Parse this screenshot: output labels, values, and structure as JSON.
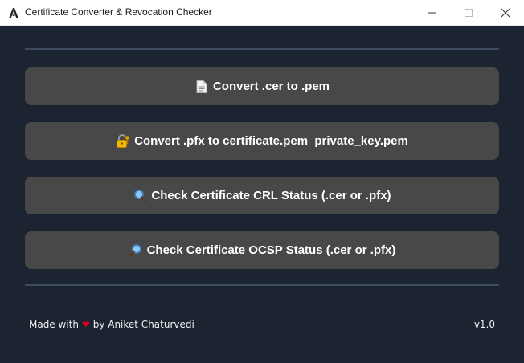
{
  "window": {
    "title": "Certificate Converter & Revocation Checker",
    "controls": {
      "minimize": "—",
      "maximize": "☐",
      "close": "✕"
    }
  },
  "buttons": [
    {
      "label": "Convert .cer to .pem",
      "icon": "document-icon"
    },
    {
      "label": "Convert .pfx to certificate.pem  private_key.pem",
      "icon": "lock-key-icon"
    },
    {
      "label": "Check Certificate CRL Status (.cer or .pfx)",
      "icon": "magnifier-icon"
    },
    {
      "label": "Check Certificate OCSP Status (.cer or .pfx)",
      "icon": "magnifier-icon"
    }
  ],
  "footer": {
    "made_with": "Made with",
    "heart": "❤",
    "by": "by Aniket Chaturvedi",
    "version": "v1.0"
  },
  "colors": {
    "background": "#1b2430",
    "button": "#484848",
    "divider": "#3e4b5e",
    "heart": "#e3001b"
  }
}
